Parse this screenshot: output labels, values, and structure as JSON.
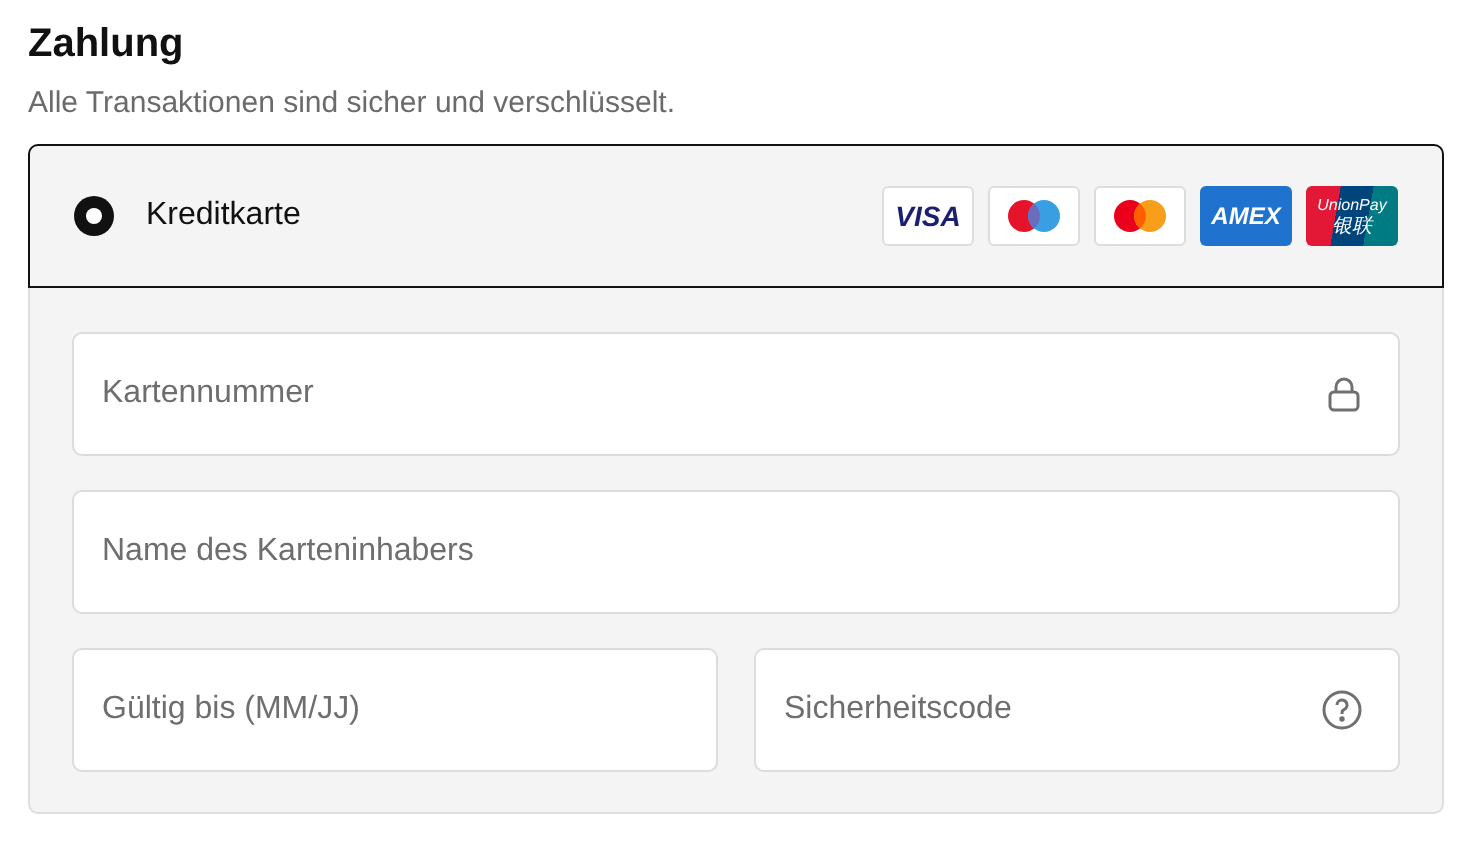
{
  "title": "Zahlung",
  "subtitle": "Alle Transaktionen sind sicher und verschlüsselt.",
  "payment_method": {
    "label": "Kreditkarte",
    "selected": true,
    "card_logos": [
      {
        "kind": "visa",
        "text": "VISA"
      },
      {
        "kind": "maestro"
      },
      {
        "kind": "mastercard"
      },
      {
        "kind": "amex",
        "text": "AMEX"
      },
      {
        "kind": "unionpay",
        "text": "UnionPay",
        "text_2": "银联"
      }
    ]
  },
  "field_rows": [
    [
      {
        "placeholder": "Kartennummer",
        "kind": "lock"
      }
    ],
    [
      {
        "placeholder": "Name des Karteninhabers",
        "kind": "plain"
      }
    ],
    [
      {
        "placeholder": "Gültig bis (MM/JJ)",
        "kind": "plain"
      },
      {
        "placeholder": "Sicherheitscode",
        "kind": "help"
      }
    ]
  ]
}
